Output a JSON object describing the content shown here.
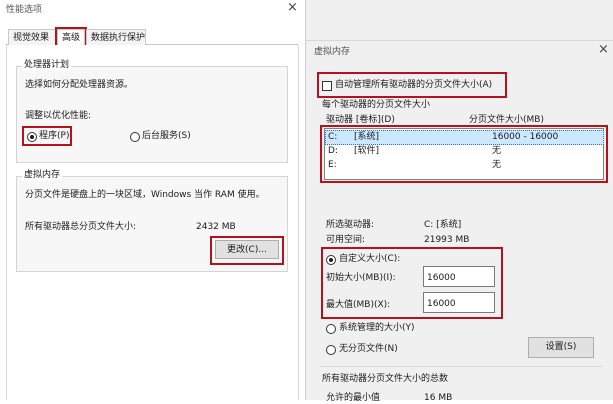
{
  "perf": {
    "title": "性能选项",
    "close": "×",
    "tabs": [
      "视觉效果",
      "高级",
      "数据执行保护"
    ],
    "processor": {
      "group_title": "处理器计划",
      "desc": "选择如何分配处理器资源。",
      "adjust_label": "调整以优化性能:",
      "opt_programs": "程序(P)",
      "opt_background": "后台服务(S)"
    },
    "virtual_memory": {
      "group_title": "虚拟内存",
      "desc": "分页文件是硬盘上的一块区域，Windows 当作 RAM 使用。",
      "total_label": "所有驱动器总分页文件大小:",
      "total_value": "2432 MB",
      "change_button": "更改(C)..."
    }
  },
  "vm": {
    "title": "虚拟内存",
    "close": "×",
    "auto_manage_label": "自动管理所有驱动器的分页文件大小(A)",
    "each_drive_group": "每个驱动器的分页文件大小",
    "col_drive": "驱动器 [卷标](D)",
    "col_size": "分页文件大小(MB)",
    "drives": [
      {
        "drive": "C:",
        "label": "[系统]",
        "size": "16000 - 16000"
      },
      {
        "drive": "D:",
        "label": "[软件]",
        "size": "无"
      },
      {
        "drive": "E:",
        "label": "",
        "size": "无"
      }
    ],
    "selected_drive_label": "所选驱动器:",
    "selected_drive_value": "C: [系统]",
    "free_space_label": "可用空间:",
    "free_space_value": "21993 MB",
    "custom_size_label": "自定义大小(C):",
    "initial_size_label": "初始大小(MB)(I):",
    "initial_size_value": "16000",
    "max_size_label": "最大值(MB)(X):",
    "max_size_value": "16000",
    "system_managed_label": "系统管理的大小(Y)",
    "no_paging_label": "无分页文件(N)",
    "set_button": "设置(S)",
    "total_group": "所有驱动器分页文件大小的总数",
    "min_allowed_partial": "允许的最小值",
    "min_allowed_value_partial": "16 MB"
  }
}
